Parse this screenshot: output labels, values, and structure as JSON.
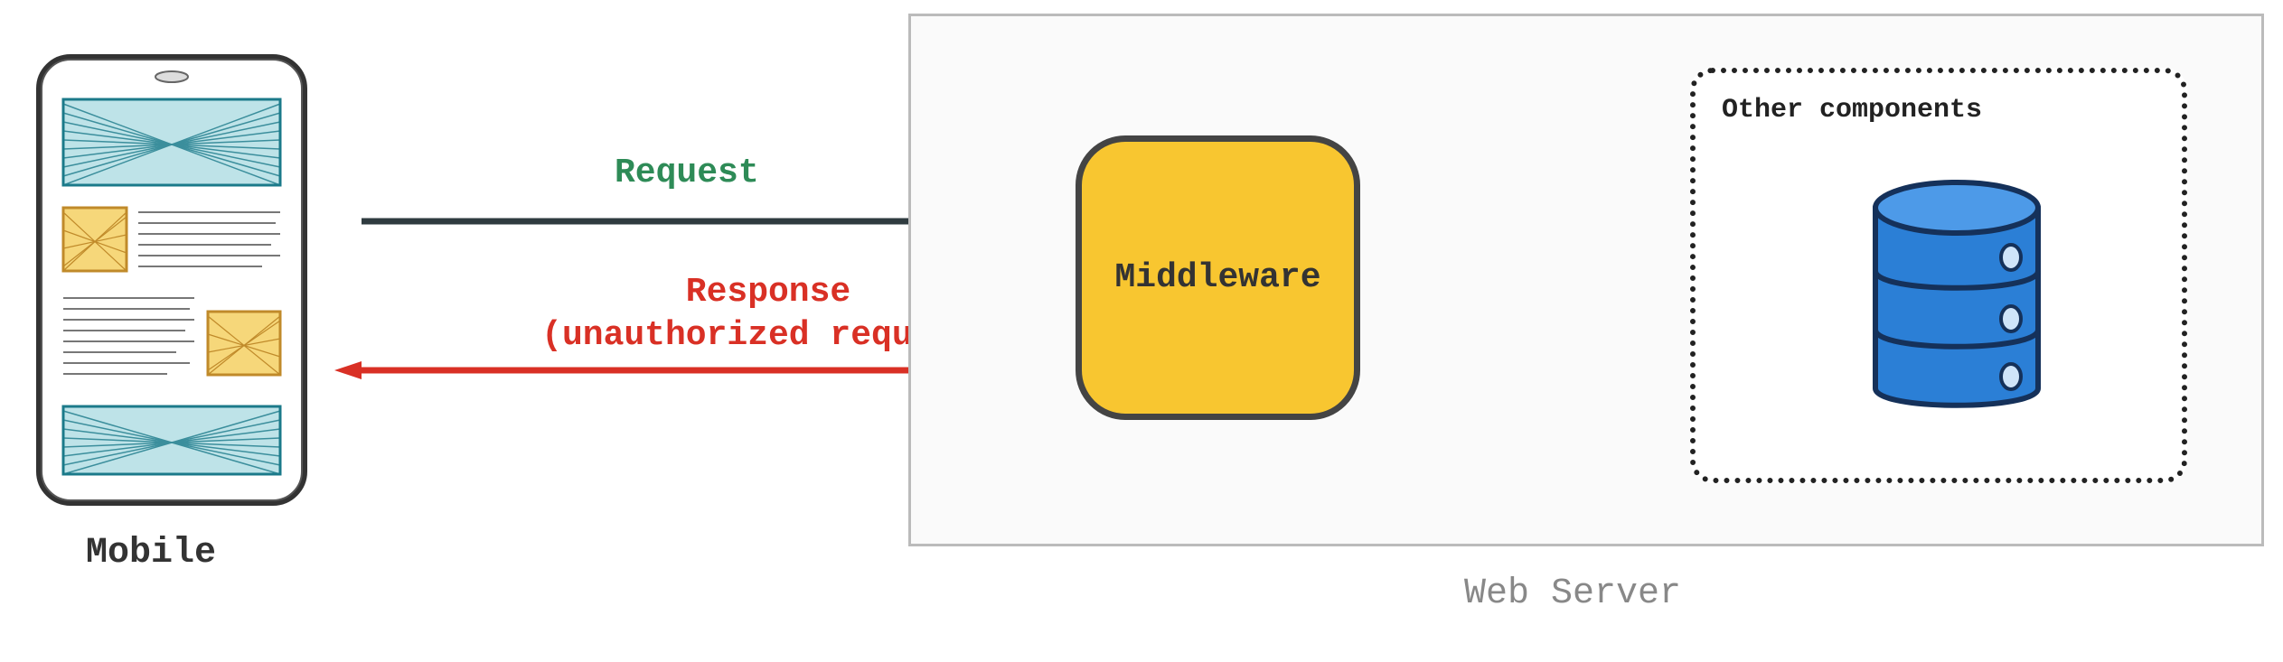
{
  "mobile": {
    "label": "Mobile"
  },
  "request": {
    "label": "Request",
    "color": "#2E8B57"
  },
  "response": {
    "label_line1": "Response",
    "label_line2": "(unauthorized request)",
    "color": "#D93025"
  },
  "webserver": {
    "label": "Web Server"
  },
  "middleware": {
    "label": "Middleware",
    "fill": "#F8C630"
  },
  "other_components": {
    "label": "Other components"
  },
  "database": {
    "fill": "#2B7FD6"
  }
}
